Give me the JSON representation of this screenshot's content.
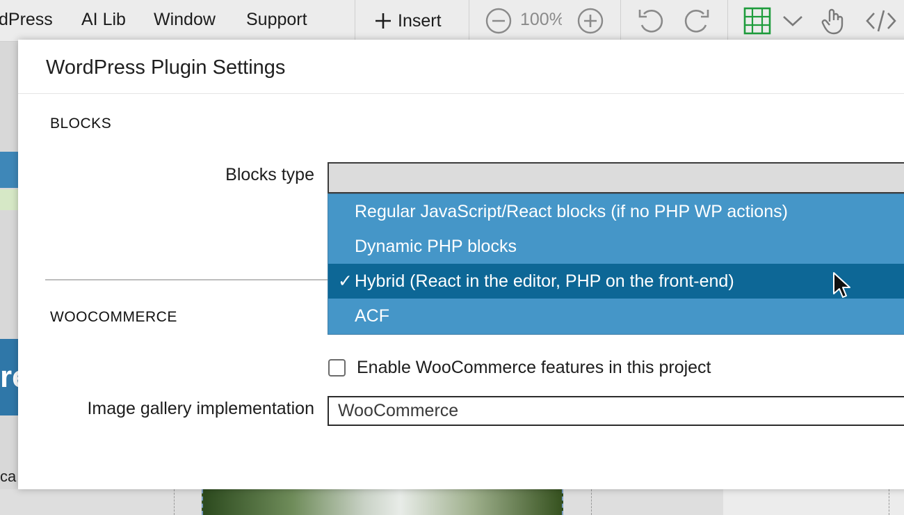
{
  "menu": {
    "items": [
      "dPress",
      "AI Lib",
      "Window",
      "Support"
    ]
  },
  "toolbar": {
    "insert_label": "Insert",
    "zoom_value": "100%",
    "icons": [
      "zoom-out-icon",
      "zoom-in-icon",
      "undo-icon",
      "redo-icon",
      "layout-grid-icon",
      "chevron-down-icon",
      "hand-pointer-icon",
      "code-icon"
    ],
    "accent_color": "#1e9c3c"
  },
  "background": {
    "cut_text_large": "re",
    "cut_text_small": "ca"
  },
  "dialog": {
    "title": "WordPress Plugin Settings",
    "blocks": {
      "heading": "BLOCKS",
      "type_label": "Blocks type",
      "options": [
        "Regular JavaScript/React blocks (if no PHP WP actions)",
        "Dynamic PHP blocks",
        "Hybrid (React in the editor, PHP on the front-end)",
        "ACF"
      ],
      "selected_index": 2,
      "check_mark": "✓"
    },
    "woocommerce": {
      "heading": "WOOCOMMERCE",
      "enable_label": "Enable WooCommerce features in this project",
      "enable_checked": false,
      "gallery_label": "Image gallery implementation",
      "gallery_value": "WooCommerce"
    }
  },
  "colors": {
    "dropdown_bg": "#4596c8",
    "dropdown_selected": "#0d6796"
  }
}
